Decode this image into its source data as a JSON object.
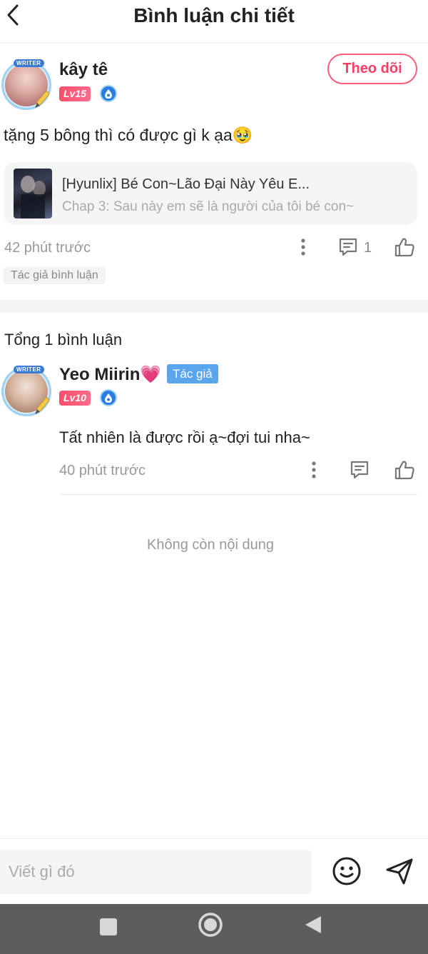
{
  "header": {
    "title": "Bình luận chi tiết"
  },
  "main_comment": {
    "username": "kây tê",
    "level": "Lv15",
    "avatar_badge": "WRITER",
    "follow_label": "Theo dõi",
    "text": "tặng 5 bông thì có được gì k ạa🥹",
    "chapter_card": {
      "title": "[Hyunlix] Bé Con~Lão Đại Này Yêu E...",
      "subtitle": "Chap 3: Sau này em sẽ là người của tôi bé con~"
    },
    "time": "42 phút trước",
    "reply_count": "1",
    "tag": "Tác giả bình luận"
  },
  "replies": {
    "total_label": "Tổng 1 bình luận",
    "items": [
      {
        "username": "Yeo Miirin💗",
        "author_tag": "Tác giả",
        "level": "Lv10",
        "avatar_badge": "WRITER",
        "text": "Tất nhiên là được rồi ạ~đợi tui nha~",
        "time": "40 phút trước"
      }
    ],
    "end_text": "Không còn nội dung"
  },
  "input": {
    "placeholder": "Viết gì đó"
  },
  "icons": {
    "back": "chevron-left-icon",
    "more": "more-vertical-icon",
    "reply": "comment-icon",
    "like": "thumbs-up-icon",
    "emoji": "smiley-icon",
    "send": "send-icon"
  },
  "colors": {
    "accent": "#ff4d6d",
    "author_tag": "#5aa6ee",
    "level_badge": "#ff4d6d"
  }
}
